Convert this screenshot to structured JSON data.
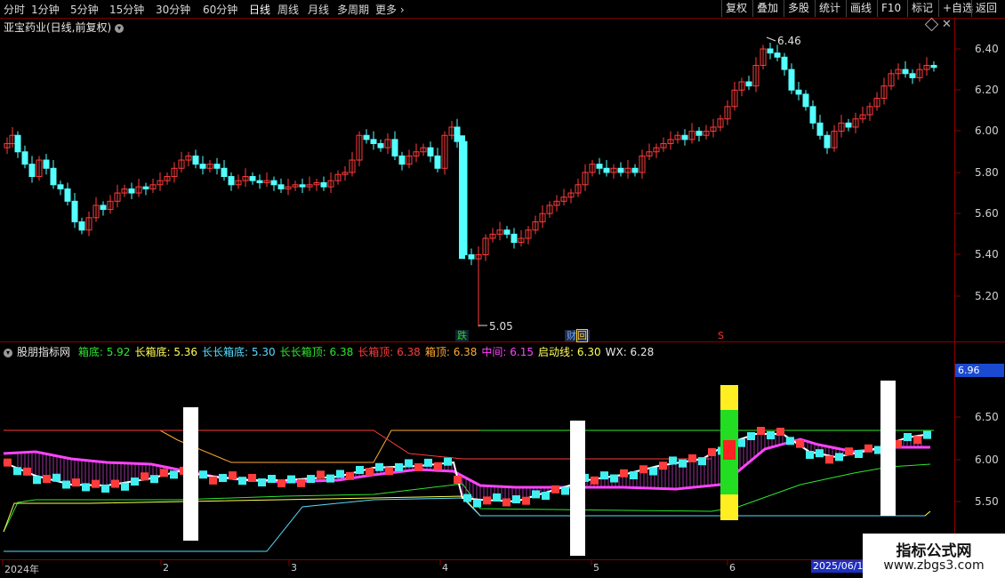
{
  "toolbar": {
    "periods": [
      "分时",
      "1分钟",
      "5分钟",
      "15分钟",
      "30分钟",
      "60分钟",
      "日线",
      "周线",
      "月线",
      "多周期",
      "更多"
    ],
    "active_period": "日线",
    "right_buttons": [
      "复权",
      "叠加",
      "多股",
      "统计",
      "画线",
      "F10",
      "标记",
      "+自选",
      "返回"
    ]
  },
  "main_chart": {
    "title": "亚宝药业(日线,前复权)",
    "y_ticks": [
      "6.40",
      "6.20",
      "6.00",
      "5.80",
      "5.60",
      "5.40",
      "5.20"
    ],
    "high_label": "6.46",
    "low_label": "5.05",
    "markers": [
      {
        "text": "跌",
        "color": "#30d030"
      },
      {
        "text": "财",
        "color": "#66aaff"
      },
      {
        "text": "回",
        "color": "#ffcc33"
      },
      {
        "text": "S",
        "color": "#ff3030"
      }
    ],
    "colors": {
      "up": "#ff3b3b",
      "down": "#54ffff"
    }
  },
  "indicator": {
    "name": "股朋指标网",
    "values": [
      {
        "label": "箱底",
        "value": "5.92",
        "color": "#2ee62e"
      },
      {
        "label": "长箱底",
        "value": "5.36",
        "color": "#ffff55"
      },
      {
        "label": "长长箱底",
        "value": "5.30",
        "color": "#55ddff"
      },
      {
        "label": "长长箱顶",
        "value": "6.38",
        "color": "#2ee62e"
      },
      {
        "label": "长箱顶",
        "value": "6.38",
        "color": "#ff3b3b"
      },
      {
        "label": "箱顶",
        "value": "6.38",
        "color": "#ffaa33"
      },
      {
        "label": "中间",
        "value": "6.15",
        "color": "#ff44ff"
      },
      {
        "label": "启动线",
        "value": "6.30",
        "color": "#ffff55"
      },
      {
        "label": "WX",
        "value": "6.28",
        "color": "#e8e8e8"
      }
    ],
    "y_ticks": [
      "6.50",
      "6.00",
      "5.50"
    ],
    "current_price_tag": "6.96"
  },
  "date_axis": {
    "labels": [
      "2024年",
      "2",
      "3",
      "4",
      "5",
      "6"
    ],
    "highlight": "2025/06/18"
  },
  "watermark": {
    "title": "指标公式网",
    "url": "www.zbgs3.com"
  }
}
